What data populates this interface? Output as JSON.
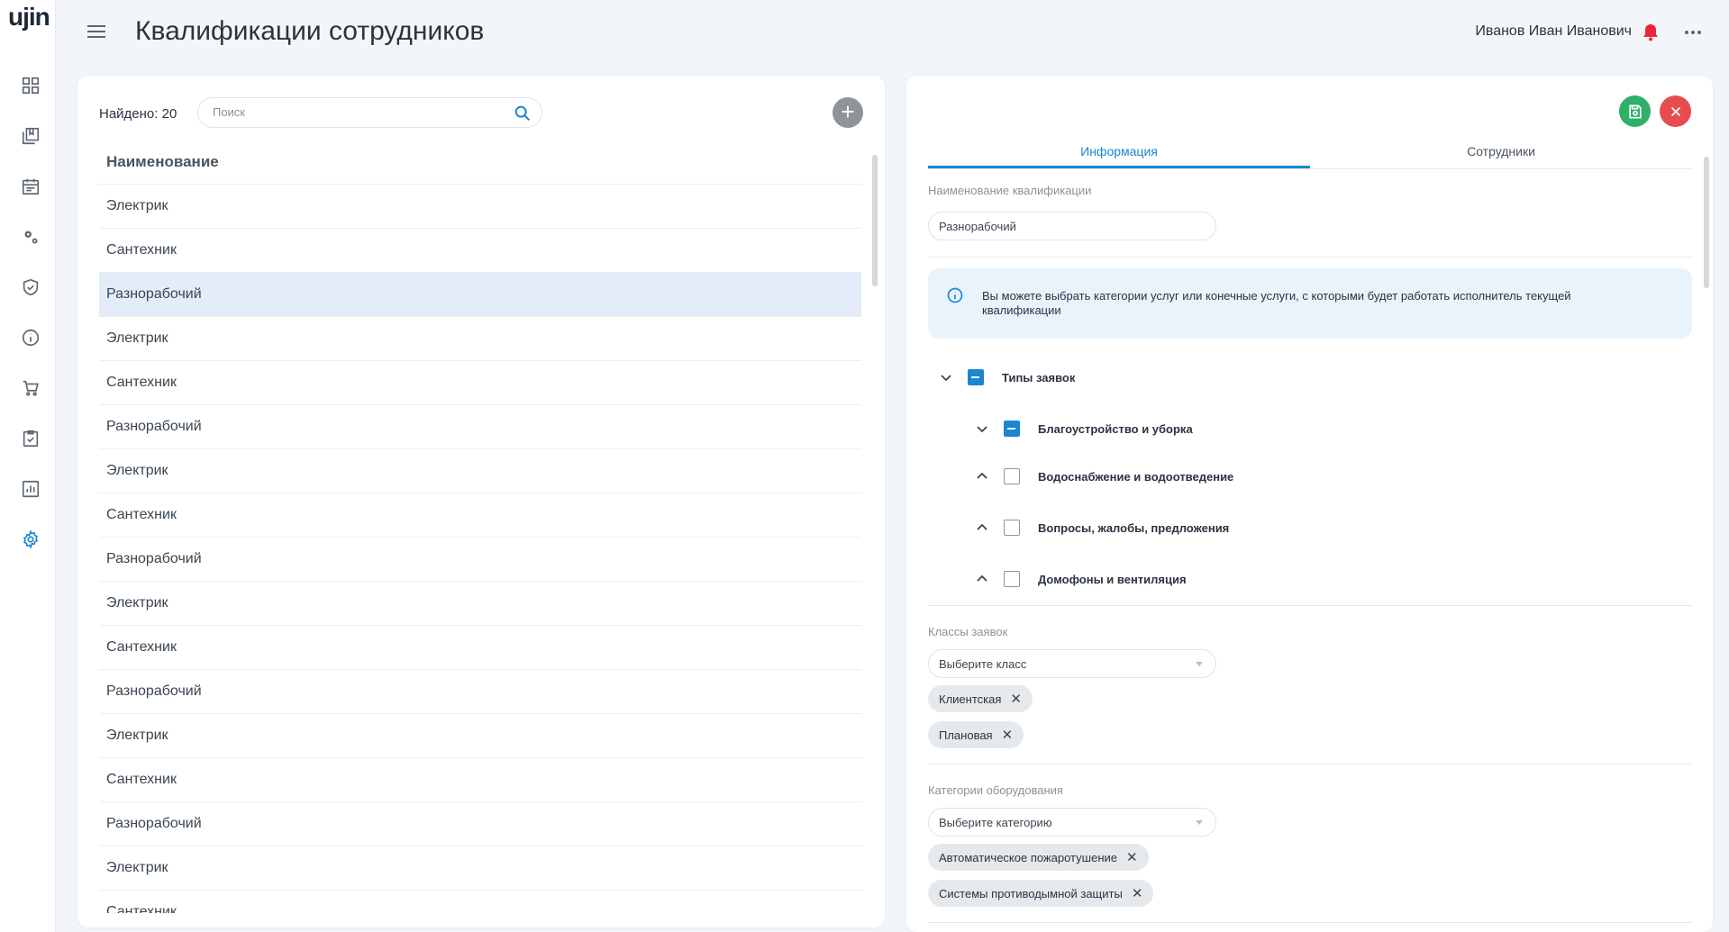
{
  "app": {
    "logo": "ujin",
    "title": "Квалификации сотрудников"
  },
  "user": {
    "name": "Иванов Иван Иванович"
  },
  "sidebar": {
    "items": [
      {
        "icon": "dashboard-icon"
      },
      {
        "icon": "journal-icon"
      },
      {
        "icon": "calendar-icon"
      },
      {
        "icon": "gears-icon"
      },
      {
        "icon": "shield-icon"
      },
      {
        "icon": "info-icon"
      },
      {
        "icon": "cart-icon"
      },
      {
        "icon": "clipboard-check-icon"
      },
      {
        "icon": "chart-icon"
      },
      {
        "icon": "settings-icon",
        "active": true
      }
    ],
    "active_color": "#1a86d0"
  },
  "list_panel": {
    "found_label": "Найдено: 20",
    "search_placeholder": "Поиск",
    "add_label": "+",
    "column_header": "Наименование",
    "items": [
      "Электрик",
      "Сантехник",
      "Разнорабочий",
      "Электрик",
      "Сантехник",
      "Разнорабочий",
      "Электрик",
      "Сантехник",
      "Разнорабочий",
      "Электрик",
      "Сантехник",
      "Разнорабочий",
      "Электрик",
      "Сантехник",
      "Разнорабочий",
      "Электрик",
      "Сантехник"
    ],
    "selected_index": 2
  },
  "detail": {
    "tabs": [
      "Информация",
      "Сотрудники"
    ],
    "active_tab": 0,
    "name_label": "Наименование квалификации",
    "name_value": "Разнорабочий",
    "info_text": "Вы можете выбрать категории услуг или конечные услуги, с которыми будет работать исполнитель текущей квалификации",
    "tree": {
      "root": "Типы заявок",
      "children": [
        "Благоустройство и уборка",
        "Водоснабжение и водоотведение",
        "Вопросы, жалобы, предложения",
        "Домофоны и вентиляция"
      ]
    },
    "classes": {
      "label": "Классы заявок",
      "placeholder": "Выберите класс",
      "chips": [
        "Клиентская",
        "Плановая"
      ]
    },
    "equipment": {
      "label": "Категории оборудования",
      "placeholder": "Выберите категорию",
      "chips": [
        "Автоматическое пожаротушение",
        "Системы противодымной защиты"
      ]
    },
    "colors": {
      "save": "#2eaf6a",
      "close": "#e84c4f",
      "accent": "#1a86d0",
      "bell": "#e8283a"
    }
  }
}
